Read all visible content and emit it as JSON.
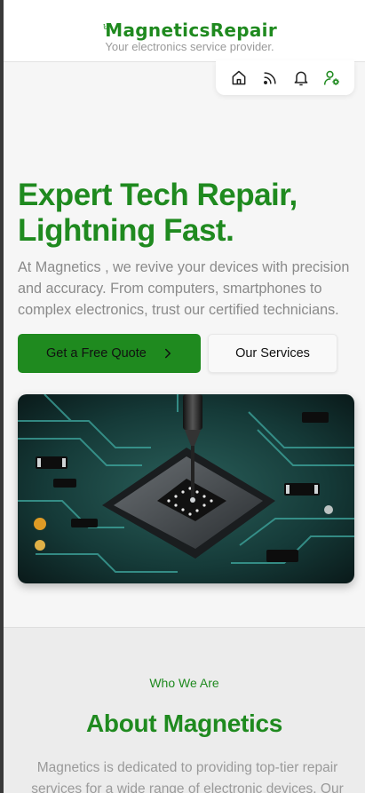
{
  "header": {
    "brand": "MagneticsRepair",
    "tagline": "Your electronics service provider."
  },
  "nav": {
    "items": [
      {
        "icon": "home-icon",
        "label": "Home"
      },
      {
        "icon": "rss-icon",
        "label": "Feed"
      },
      {
        "icon": "bell-icon",
        "label": "Notifications"
      },
      {
        "icon": "user-settings-icon",
        "label": "Account"
      }
    ]
  },
  "hero": {
    "title_line1": "Expert Tech Repair,",
    "title_line2": "Lightning Fast.",
    "description": "At Magnetics , we revive your devices with precision and accuracy. From computers, smartphones to complex electronics, trust our certified technicians.",
    "primary_button": "Get a Free Quote",
    "secondary_button": "Our Services",
    "image_icon": "circuit-board-chip-image"
  },
  "about": {
    "eyebrow": "Who We Are",
    "title": "About Magnetics",
    "text": "Magnetics is dedicated to providing top-tier repair services for a wide range of electronic devices. Our"
  },
  "colors": {
    "brand_green": "#1f8a1f",
    "background": "#f6f6f6",
    "section_alt": "#ececec"
  }
}
